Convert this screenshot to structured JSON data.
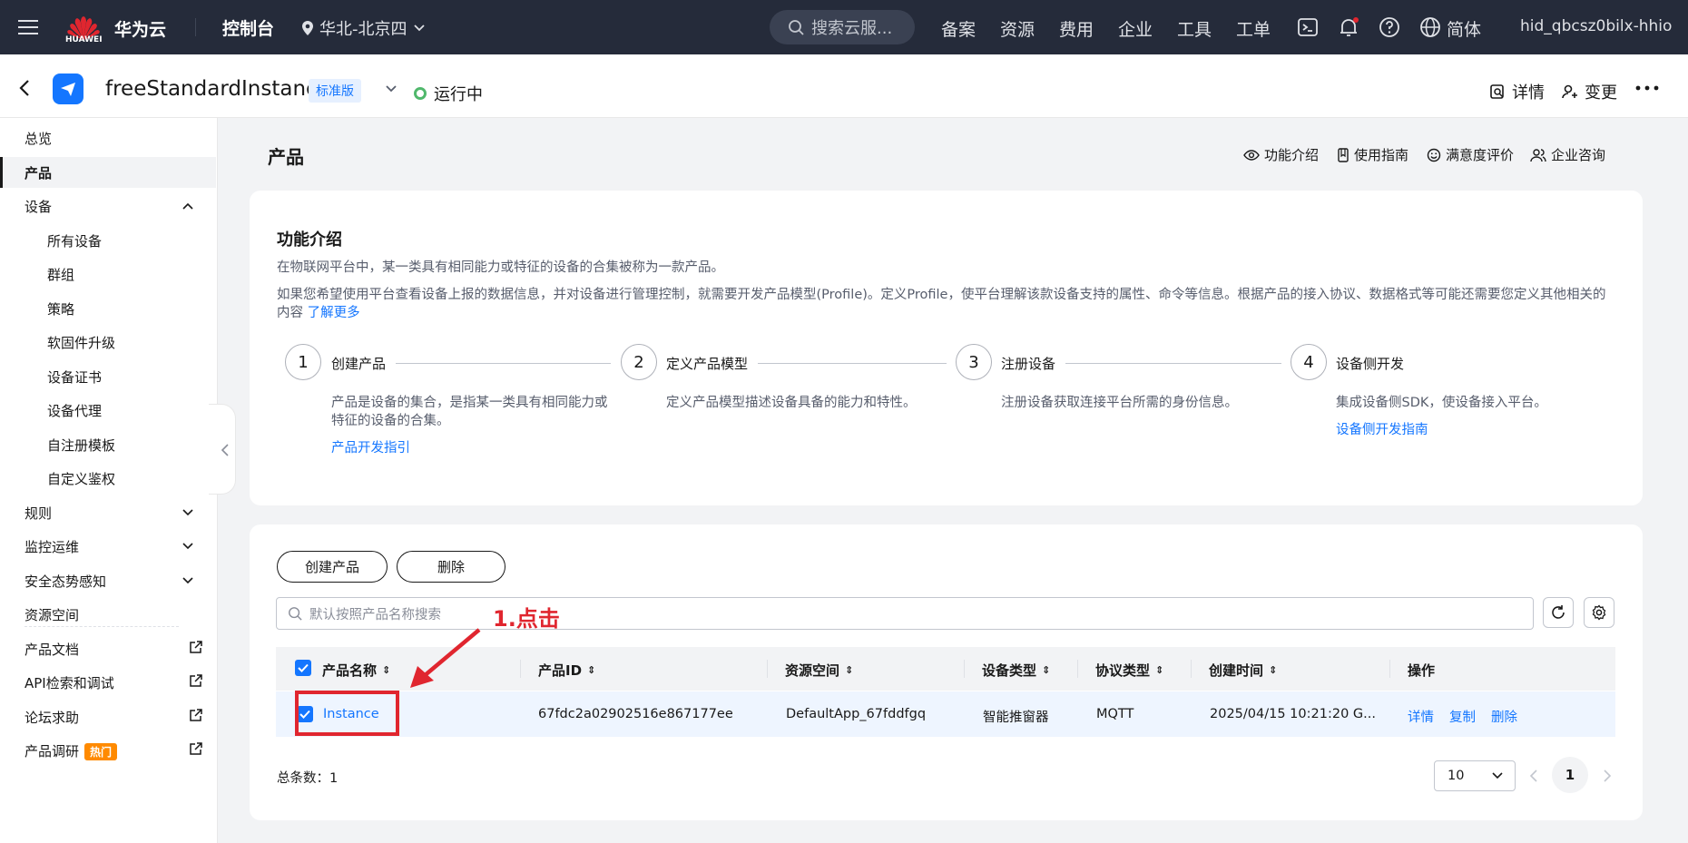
{
  "topbar": {
    "brand": "华为云",
    "logo_word": "HUAWEI",
    "console": "控制台",
    "region": "华北-北京四",
    "search_placeholder": "搜索云服...",
    "links": [
      "备案",
      "资源",
      "费用",
      "企业",
      "工具",
      "工单"
    ],
    "lang": "简体",
    "user": "hid_qbcsz0bilx-hhio"
  },
  "instance": {
    "name": "freeStandardInstance",
    "edition": "标准版",
    "status": "运行中",
    "detail_label": "详情",
    "change_label": "变更"
  },
  "sidebar": {
    "overview": "总览",
    "product": "产品",
    "device": "设备",
    "device_sub": [
      "所有设备",
      "群组",
      "策略",
      "软固件升级",
      "设备证书",
      "设备代理",
      "自注册模板",
      "自定义鉴权"
    ],
    "rules": "规则",
    "monitor": "监控运维",
    "security": "安全态势感知",
    "resource_space": "资源空间",
    "docs": "产品文档",
    "api": "API检索和调试",
    "forum": "论坛求助",
    "survey": "产品调研",
    "hot": "热门"
  },
  "page": {
    "title": "产品",
    "toplinks": [
      "功能介绍",
      "使用指南",
      "满意度评价",
      "企业咨询"
    ]
  },
  "intro": {
    "title": "功能介绍",
    "line1": "在物联网平台中，某一类具有相同能力或特征的设备的合集被称为一款产品。",
    "line2": "如果您希望使用平台查看设备上报的数据信息，并对设备进行管理控制，就需要开发产品模型(Profile)。定义Profile，使平台理解该款设备支持的属性、命令等信息。根据产品的接入协议、数据格式等可能还需要您定义其他相关的内容",
    "learn_more": "了解更多",
    "steps": [
      {
        "num": "1",
        "title": "创建产品",
        "desc": "产品是设备的集合，是指某一类具有相同能力或特征的设备的合集。",
        "link": "产品开发指引"
      },
      {
        "num": "2",
        "title": "定义产品模型",
        "desc": "定义产品模型描述设备具备的能力和特性。",
        "link": ""
      },
      {
        "num": "3",
        "title": "注册设备",
        "desc": "注册设备获取连接平台所需的身份信息。",
        "link": ""
      },
      {
        "num": "4",
        "title": "设备侧开发",
        "desc": "集成设备侧SDK，使设备接入平台。",
        "link": "设备侧开发指南"
      }
    ]
  },
  "table": {
    "create_btn": "创建产品",
    "delete_btn": "删除",
    "search_placeholder": "默认按照产品名称搜索",
    "columns": [
      "产品名称",
      "产品ID",
      "资源空间",
      "设备类型",
      "协议类型",
      "创建时间",
      "操作"
    ],
    "rows": [
      {
        "name": "Instance",
        "id": "67fdc2a02902516e867177ee",
        "space": "DefaultApp_67fddfgq",
        "device_type": "智能推窗器",
        "protocol": "MQTT",
        "created": "2025/04/15 10:21:20 G...",
        "actions": [
          "详情",
          "复制",
          "删除"
        ]
      }
    ],
    "total_label": "总条数：1",
    "page_size": "10",
    "current_page": "1"
  },
  "annotation": "1.点击",
  "colors": {
    "accent": "#1476ff",
    "annotation": "#e0262f",
    "topbar": "#252b3a",
    "running": "#50b86c",
    "hot": "#ff8a00"
  }
}
